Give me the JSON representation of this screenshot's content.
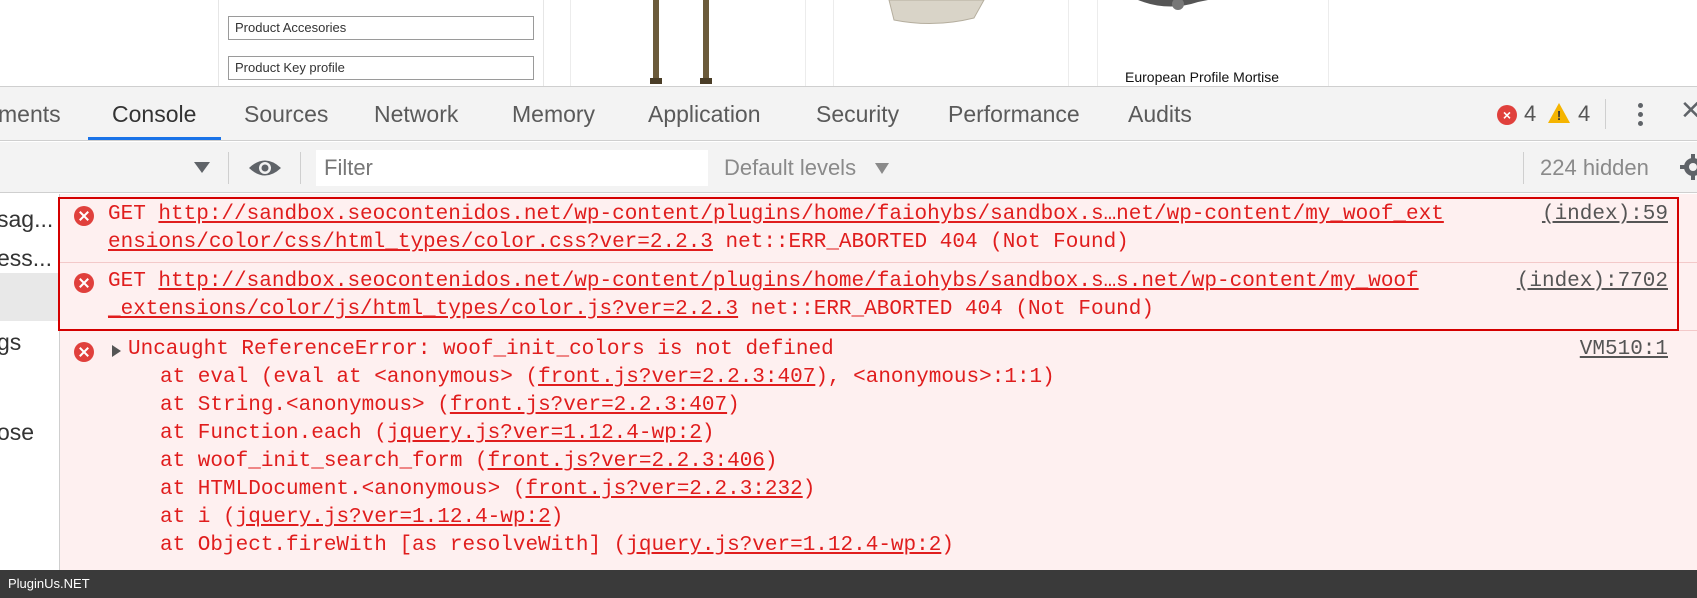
{
  "page": {
    "fields": [
      "Product Accesories",
      "Product Key profile"
    ],
    "product_title": "European Profile Mortise"
  },
  "devtools": {
    "tabs": [
      "ments",
      "Console",
      "Sources",
      "Network",
      "Memory",
      "Application",
      "Security",
      "Performance",
      "Audits"
    ],
    "active_tab": "Console",
    "error_count": "4",
    "warning_count": "4",
    "toolbar": {
      "filter_placeholder": "Filter",
      "levels_label": "Default levels",
      "hidden_label": "224 hidden"
    },
    "sidebar_items": [
      "sag...",
      "ess...",
      "gs",
      "ose"
    ],
    "messages": [
      {
        "method": "GET",
        "url_line1": "http://sandbox.seocontenidos.net/wp-content/plugins/home/faiohybs/sandbox.s…net/wp-content/my_woof_ext",
        "url_line2": "ensions/color/css/html_types/color.css?ver=2.2.3",
        "status": "net::ERR_ABORTED 404 (Not Found)",
        "source": "(index):59"
      },
      {
        "method": "GET",
        "url_line1": "http://sandbox.seocontenidos.net/wp-content/plugins/home/faiohybs/sandbox.s…s.net/wp-content/my_woof",
        "url_line2": "_extensions/color/js/html_types/color.js?ver=2.2.3",
        "status": "net::ERR_ABORTED 404 (Not Found)",
        "source": "(index):7702"
      }
    ],
    "exception": {
      "title": "Uncaught ReferenceError: woof_init_colors is not defined",
      "source": "VM510:1",
      "stack": [
        {
          "prefix": "at eval (eval at <anonymous> (",
          "link": "front.js?ver=2.2.3:407",
          "suffix": "), <anonymous>:1:1)"
        },
        {
          "prefix": "at String.<anonymous> (",
          "link": "front.js?ver=2.2.3:407",
          "suffix": ")"
        },
        {
          "prefix": "at Function.each (",
          "link": "jquery.js?ver=1.12.4-wp:2",
          "suffix": ")"
        },
        {
          "prefix": "at woof_init_search_form (",
          "link": "front.js?ver=2.2.3:406",
          "suffix": ")"
        },
        {
          "prefix": "at HTMLDocument.<anonymous> (",
          "link": "front.js?ver=2.2.3:232",
          "suffix": ")"
        },
        {
          "prefix": "at i (",
          "link": "jquery.js?ver=1.12.4-wp:2",
          "suffix": ")"
        },
        {
          "prefix": "at Object.fireWith [as resolveWith] (",
          "link": "jquery.js?ver=1.12.4-wp:2",
          "suffix": ")"
        }
      ]
    }
  },
  "footer": {
    "label": "PluginUs.NET"
  },
  "colors": {
    "error": "#e01d1d",
    "error_bg": "#fef0f0",
    "accent": "#1a73e8",
    "warning": "#f5b400"
  }
}
